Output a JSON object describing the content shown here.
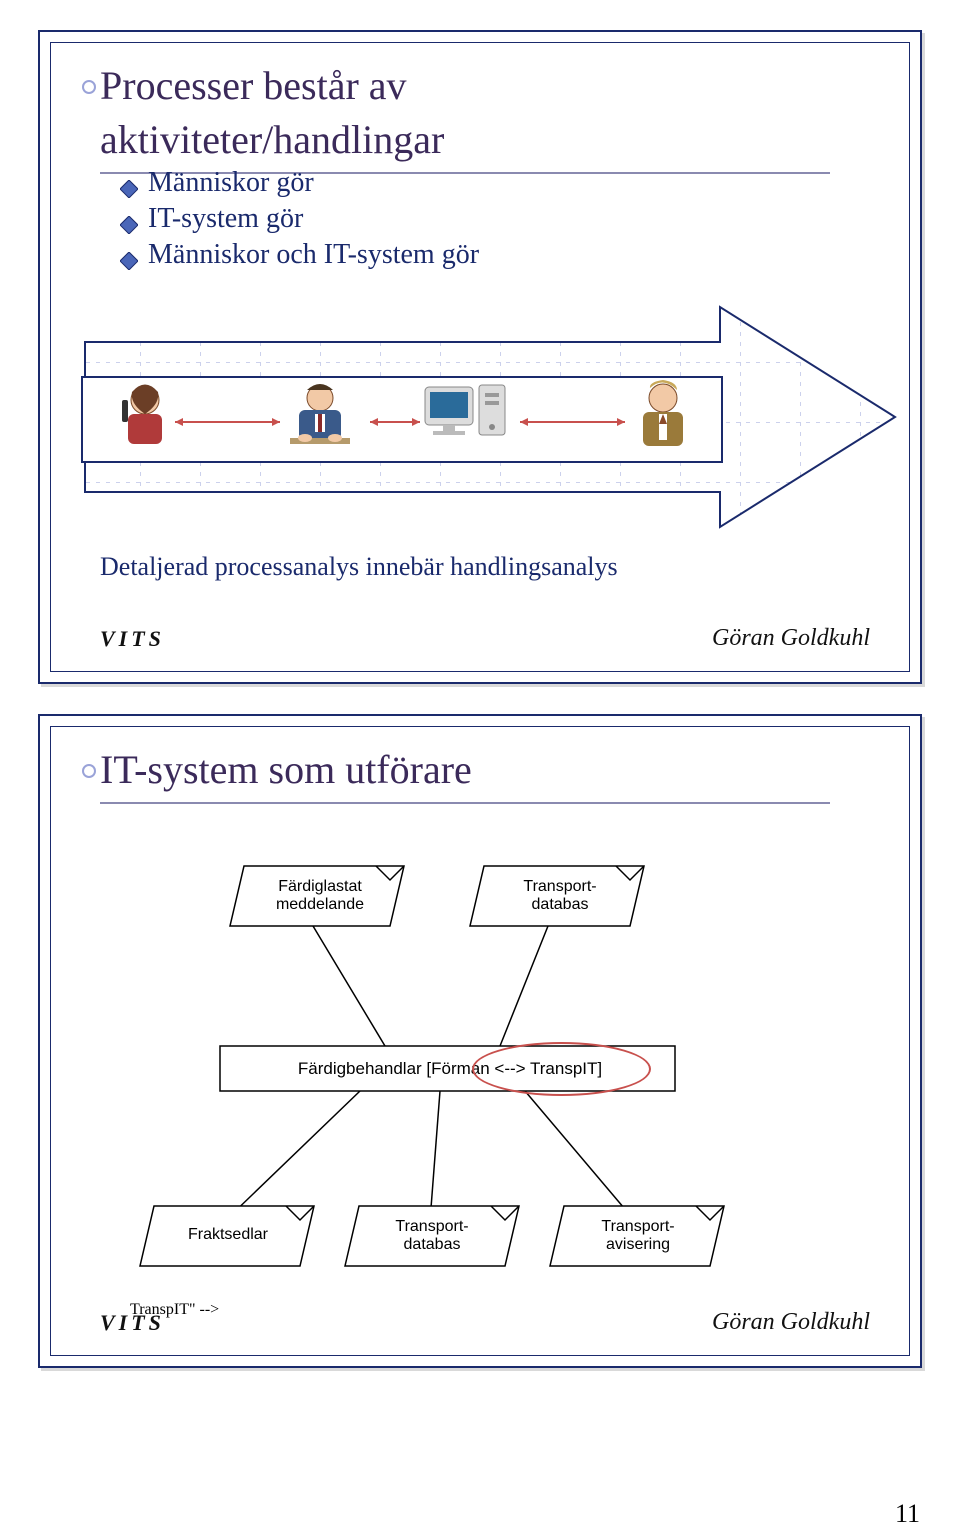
{
  "page_number": "11",
  "slide1": {
    "title_line1": "Processer består av",
    "title_line2": "aktiviteter/handlingar",
    "bullets": [
      "Människor gör",
      "IT-system gör",
      "Människor och IT-system gör"
    ],
    "footnote": "Detaljerad processanalys innebär handlingsanalys",
    "vits": "VITS",
    "author": "Göran Goldkuhl"
  },
  "slide2": {
    "title": "IT-system som utförare",
    "top_boxes": {
      "left": {
        "line1": "Färdiglastat",
        "line2": "meddelande"
      },
      "right": {
        "line1": "Transport-",
        "line2": "databas"
      }
    },
    "middle_box": "Färdigbehandlar [Förman <--> TranspIT]",
    "bottom_boxes": {
      "left": "Fraktsedlar",
      "mid": {
        "line1": "Transport-",
        "line2": "databas"
      },
      "right": {
        "line1": "Transport-",
        "line2": "avisering"
      }
    },
    "vits": "VITS",
    "author": "Göran Goldkuhl"
  }
}
